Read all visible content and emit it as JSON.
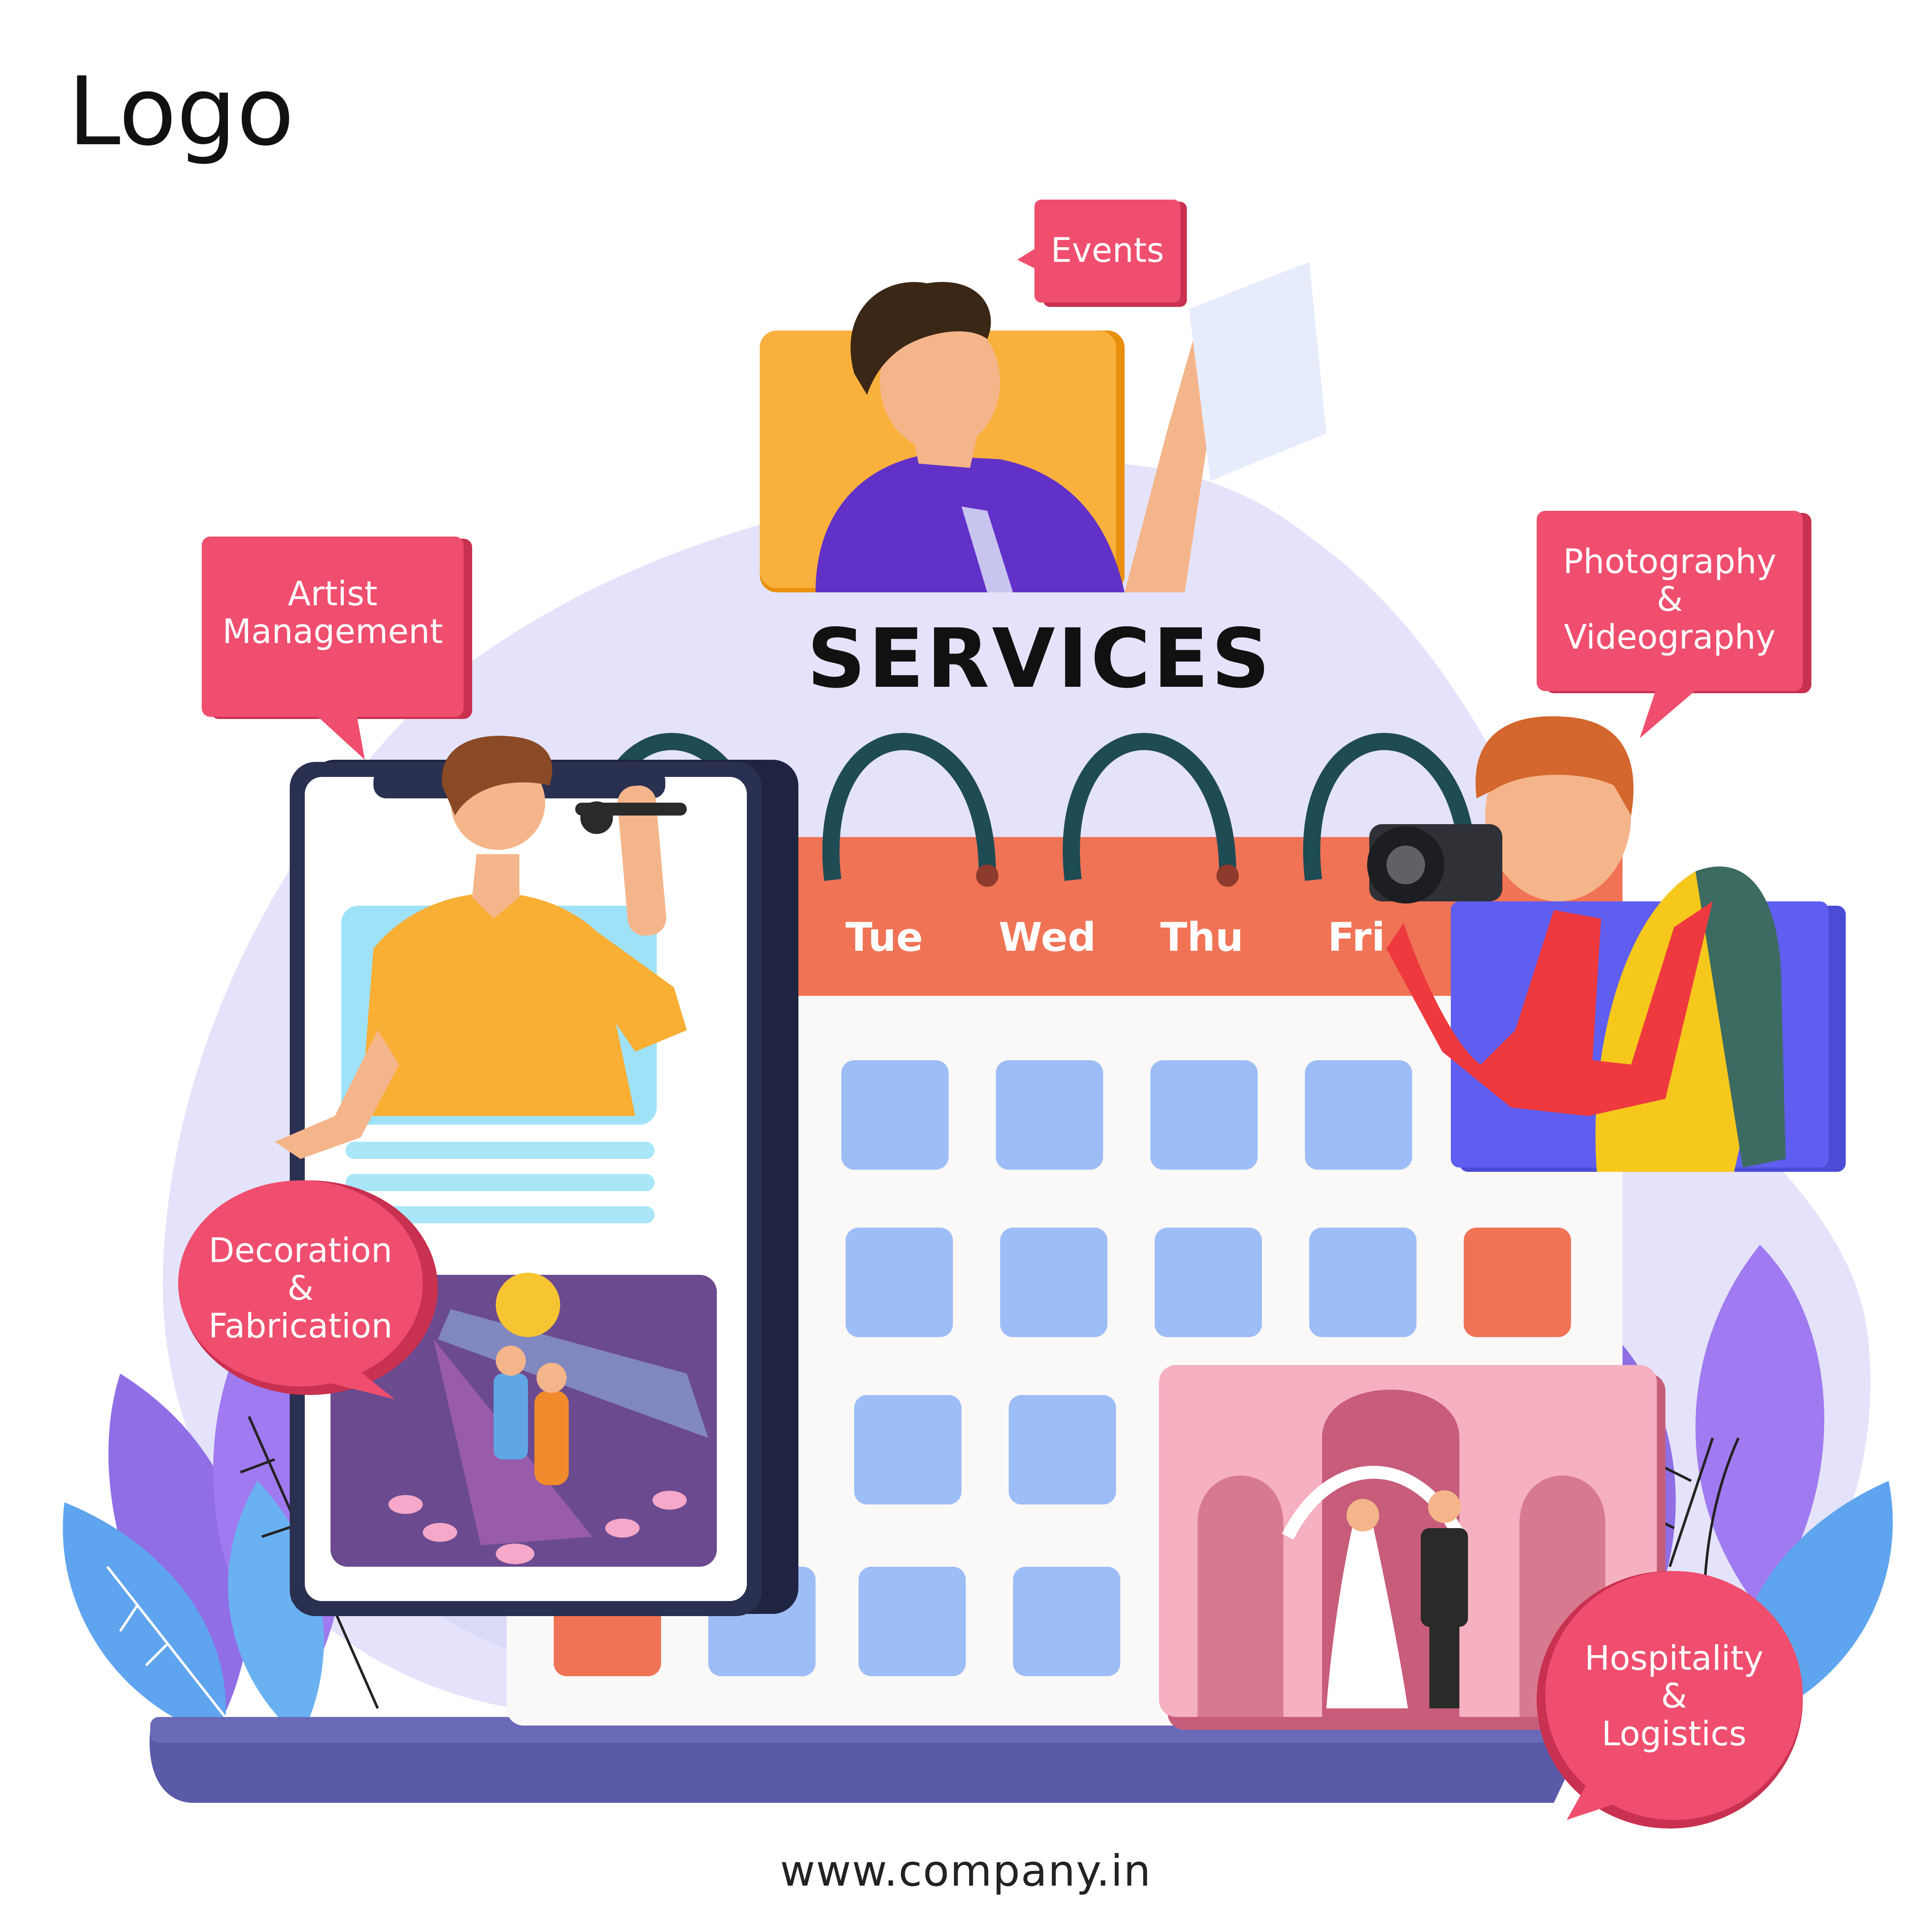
{
  "header": {
    "logo_text": "Logo"
  },
  "title": "SERVICES",
  "calendar": {
    "days": [
      "Tue",
      "Wed",
      "Thu",
      "Fri"
    ]
  },
  "tags": {
    "events": [
      "Events"
    ],
    "artist": [
      "Artist",
      "Management"
    ],
    "photo": [
      "Photography",
      "&",
      "Videography"
    ],
    "decoration": [
      "Decoration",
      "&",
      "Fabrication"
    ],
    "hospitality": [
      "Hospitality",
      "&",
      "Logistics"
    ]
  },
  "footer": {
    "url": "www.company.in"
  },
  "colors": {
    "tag_pink": "#f04e6e",
    "calendar_header": "#f07355",
    "cell_blue": "#9dbdf6",
    "blob_lavender": "#e4e3fb",
    "base_purple": "#5a5aa8"
  },
  "icons": [
    "event-planner-illustration",
    "singer-illustration",
    "photographer-illustration",
    "party-illustration",
    "wedding-illustration",
    "smartphone-illustration",
    "calendar-illustration",
    "leaf-decoration"
  ]
}
